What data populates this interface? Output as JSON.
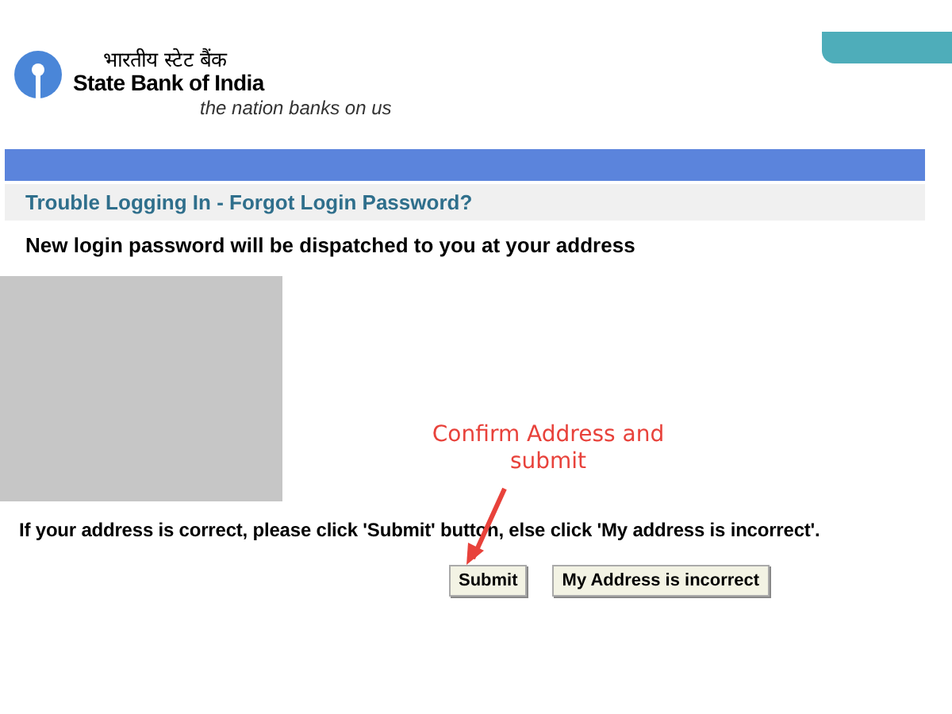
{
  "header": {
    "hindi_name": "भारतीय स्टेट बैंक",
    "bank_name": "State Bank of India",
    "tagline": "the nation banks on us"
  },
  "section_title": "Trouble Logging In - Forgot Login Password?",
  "message": "New login password will be dispatched to you at your address",
  "instruction": "If your address is correct, please click 'Submit' button, else click 'My address is incorrect'.",
  "annotation": "Confirm Address and submit",
  "buttons": [
    "Submit",
    "My Address is incorrect"
  ]
}
